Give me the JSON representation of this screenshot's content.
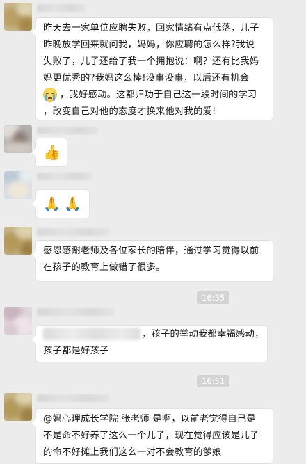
{
  "messages": [
    {
      "lines": [
        "昨天去一家单位应聘失败，回家情绪有点低落，儿子",
        "昨晚放学回来就问我，妈妈，你应聘的怎么样?我说",
        "失败了，儿子还给了我一个拥抱说：啊？还有比我妈",
        "妈更优秀的?我妈这么棒!没事没事，以后还有机会",
        "，我好感动。这都归功于自己这一段时间的学习",
        "，改变自己对他的态度才换来他对我的爱!"
      ]
    },
    {
      "icon": "thumbs-up-icon",
      "glyph": "👍"
    },
    {
      "icon": "praying-hands-icon",
      "glyph": "🙏"
    },
    {
      "lines": [
        "感恩感谢老师及各位家长的陪伴，通过学习觉得以前",
        "在孩子的教育上做错了很多。"
      ]
    },
    {
      "lines": [
        "，孩子的举动我都幸福感动，",
        "孩子都是好孩子"
      ]
    },
    {
      "lines": [
        "@妈心理成长学院 张老师 是啊，以前老觉得自己是",
        "不是命不好养了这么一个儿子，现在觉得应该是儿子",
        "的命不好摊上我们这么一对不会教育的爹娘"
      ]
    }
  ],
  "timestamps": [
    "16:35",
    "16:51"
  ],
  "colors": {
    "background": "#ececec",
    "bubble": "#ffffff",
    "timestamp_bg": "#d4d4d4"
  }
}
